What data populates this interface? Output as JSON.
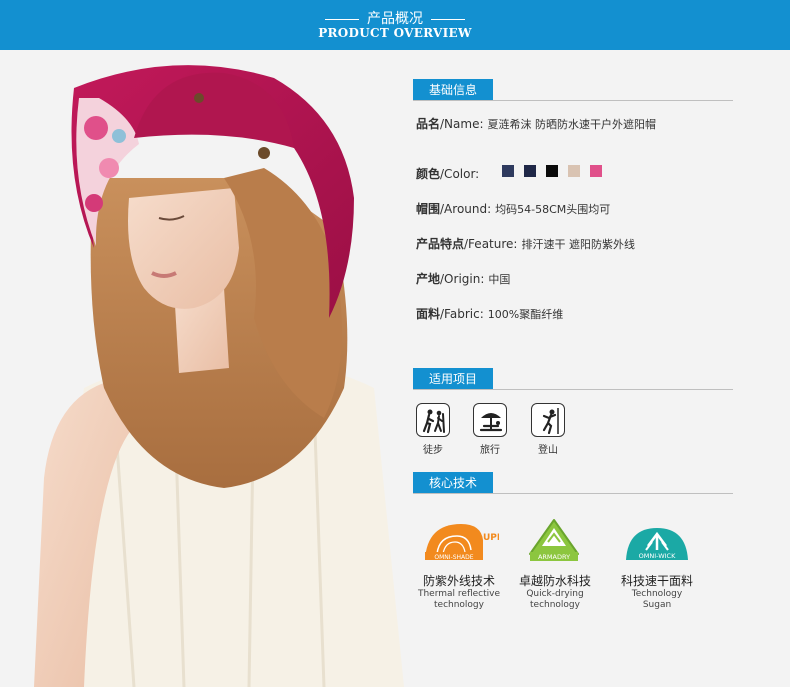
{
  "header": {
    "title_cn": "产品概况",
    "title_en": "PRODUCT OVERVIEW"
  },
  "basic_info": {
    "section_title": "基础信息",
    "rows": [
      {
        "label": "品名",
        "label_en": "/Name:",
        "value": "夏涟希沫 防晒防水速干户外遮阳帽"
      },
      {
        "label": "颜色",
        "label_en": "/Color:",
        "value": ""
      },
      {
        "label": "帽围",
        "label_en": "/Around:",
        "value": "均码54-58CM头围均可"
      },
      {
        "label": "产品特点",
        "label_en": "/Feature:",
        "value": "排汗速干 遮阳防紫外线"
      },
      {
        "label": "产地",
        "label_en": "/Origin:",
        "value": "中国"
      },
      {
        "label": "面料",
        "label_en": "/Fabric:",
        "value": "100%聚酯纤维"
      }
    ],
    "colors": [
      "#2e3a5e",
      "#1f2747",
      "#0a0a0a",
      "#d9c3b2",
      "#e0508a"
    ]
  },
  "usage": {
    "section_title": "适用项目",
    "items": [
      {
        "icon": "hiking-icon",
        "label": "徒步"
      },
      {
        "icon": "travel-icon",
        "label": "旅行"
      },
      {
        "icon": "climbing-icon",
        "label": "登山"
      }
    ]
  },
  "tech": {
    "section_title": "核心技术",
    "items": [
      {
        "icon": "omni-shade-icon",
        "badge": "OMNI-SHADE",
        "upf": "UPF50",
        "title": "防紫外线技术",
        "sub1": "Thermal reflective",
        "sub2": "technology"
      },
      {
        "icon": "armadry-icon",
        "badge": "ARMADRY",
        "title": "卓越防水科技",
        "sub1": "Quick-drying",
        "sub2": "technology"
      },
      {
        "icon": "omni-wick-icon",
        "badge": "OMNI-WICK",
        "title": "科技速干面料",
        "sub1": "Technology",
        "sub2": "Sugan"
      }
    ]
  }
}
